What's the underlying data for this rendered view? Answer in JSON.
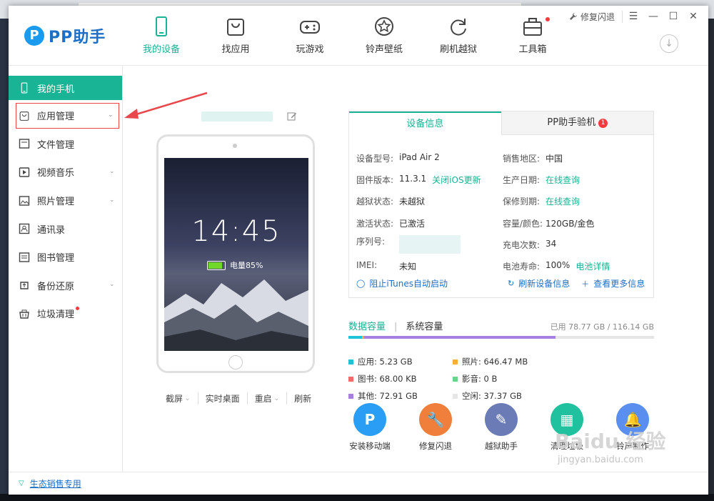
{
  "app": {
    "logo_text": "PP助手",
    "logo_mark": "P"
  },
  "nav": [
    {
      "label": "我的设备",
      "icon": "phone-icon",
      "active": true
    },
    {
      "label": "找应用",
      "icon": "bag-icon",
      "active": false
    },
    {
      "label": "玩游戏",
      "icon": "gamepad-icon",
      "active": false
    },
    {
      "label": "铃声壁纸",
      "icon": "star-icon",
      "active": false
    },
    {
      "label": "刷机越狱",
      "icon": "refresh-icon",
      "active": false
    },
    {
      "label": "工具箱",
      "icon": "toolbox-icon",
      "active": false
    }
  ],
  "window": {
    "fix_label": "修复闪退"
  },
  "sidebar": {
    "items": [
      {
        "label": "我的手机",
        "icon": "phone-icon",
        "active": true
      },
      {
        "label": "应用管理",
        "icon": "bag-icon",
        "chevron": true
      },
      {
        "label": "文件管理",
        "icon": "folder-icon"
      },
      {
        "label": "视频音乐",
        "icon": "video-icon",
        "chevron": true
      },
      {
        "label": "照片管理",
        "icon": "photo-icon",
        "chevron": true
      },
      {
        "label": "通讯录",
        "icon": "contacts-icon"
      },
      {
        "label": "图书管理",
        "icon": "book-icon"
      },
      {
        "label": "备份还原",
        "icon": "backup-icon",
        "chevron": true
      },
      {
        "label": "垃圾清理",
        "icon": "trash-icon",
        "dot": true
      }
    ]
  },
  "footer": {
    "link": "生态销售专用"
  },
  "device": {
    "clock": "14:45",
    "battery_label": "电量85%",
    "battery_percent": 85,
    "actions": [
      "截屏",
      "实时桌面",
      "重启",
      "刷新"
    ]
  },
  "info": {
    "tab_active": "设备信息",
    "tab_other": "PP助手验机",
    "tab_other_badge": "1",
    "rows": [
      [
        {
          "k": "设备型号:",
          "v": "iPad Air 2"
        },
        {
          "k": "销售地区:",
          "v": "中国"
        }
      ],
      [
        {
          "k": "固件版本:",
          "v": "11.3.1",
          "link": "关闭iOS更新"
        },
        {
          "k": "生产日期:",
          "link": "在线查询"
        }
      ],
      [
        {
          "k": "越狱状态:",
          "v": "未越狱"
        },
        {
          "k": "保修到期:",
          "link": "在线查询"
        }
      ],
      [
        {
          "k": "激活状态:",
          "v": "已激活"
        },
        {
          "k": "容量/颜色:",
          "v": "120GB/金色"
        }
      ],
      [
        {
          "k": "序列号:"
        },
        {
          "k": "充电次数:",
          "v": "34"
        }
      ],
      [
        {
          "k": "IMEI:",
          "v": "未知"
        },
        {
          "k": "电池寿命:",
          "v": "100%",
          "link": "电池详情"
        }
      ]
    ],
    "foot_left": "阻止iTunes自动启动",
    "foot_refresh": "刷新设备信息",
    "foot_more": "查看更多信息"
  },
  "storage": {
    "tab_active": "数据容量",
    "tab_other": "系统容量",
    "used_text": "已用 78.77 GB / 116.14 GB",
    "used_gb": 78.77,
    "total_gb": 116.14,
    "legend": [
      {
        "label": "应用: 5.23 GB",
        "color": "#1ec3d6",
        "gb": 5.23
      },
      {
        "label": "照片: 646.47 MB",
        "color": "#f6b035",
        "gb": 0.63
      },
      {
        "label": "图书: 68.00 KB",
        "color": "#f26b6b",
        "gb": 0.0
      },
      {
        "label": "影音: 0 B",
        "color": "#6ad38a",
        "gb": 0
      },
      {
        "label": "其他: 72.91 GB",
        "color": "#a77fe0",
        "gb": 72.91
      },
      {
        "label": "空闲: 37.37 GB",
        "color": "#e6e6e6",
        "gb": 37.37
      }
    ]
  },
  "tools": [
    {
      "label": "安装移动端",
      "color": "#2a9df4",
      "glyph": "P",
      "icon": "pp-icon"
    },
    {
      "label": "修复闪退",
      "color": "#f07f3c",
      "glyph": "🔧",
      "icon": "wrench-icon"
    },
    {
      "label": "越狱助手",
      "color": "#6a7bb5",
      "glyph": "✎",
      "icon": "jailbreak-icon"
    },
    {
      "label": "清理垃圾",
      "color": "#20c19e",
      "glyph": "▦",
      "icon": "broom-icon"
    },
    {
      "label": "铃声制作",
      "color": "#5a8ff0",
      "glyph": "🔔",
      "icon": "bell-icon"
    }
  ],
  "watermark": {
    "main": "Baidu 经验",
    "sub": "jingyan.baidu.com"
  }
}
